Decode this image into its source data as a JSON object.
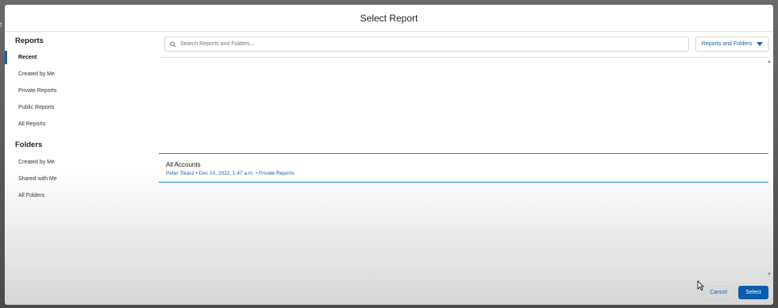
{
  "modal": {
    "title": "Select Report"
  },
  "sidebar": {
    "reports_heading": "Reports",
    "report_items": [
      {
        "label": "Recent",
        "active": true
      },
      {
        "label": "Created by Me"
      },
      {
        "label": "Private Reports"
      },
      {
        "label": "Public Reports"
      },
      {
        "label": "All Reports"
      }
    ],
    "folders_heading": "Folders",
    "folder_items": [
      {
        "label": "Created by Me"
      },
      {
        "label": "Shared with Me"
      },
      {
        "label": "All Folders"
      }
    ]
  },
  "search": {
    "placeholder": "Search Reports and Folders..."
  },
  "filter": {
    "label": "Reports and Folders"
  },
  "results": [
    {
      "name": "All Accounts",
      "meta": "Peter Tikasz • Dec 10, 2022, 1:47 a.m. • Private Reports"
    }
  ],
  "footer": {
    "cancel_label": "Cancel",
    "select_label": "Select"
  },
  "colors": {
    "accent": "#1b5fb2",
    "primary_button": "#0b5cab",
    "row_border": "#1b8ac9"
  }
}
